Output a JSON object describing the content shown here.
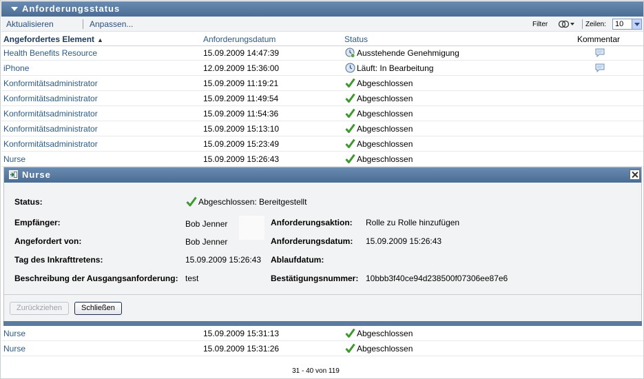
{
  "portlet": {
    "title": "Anforderungsstatus"
  },
  "toolbar": {
    "refresh_label": "Aktualisieren",
    "customize_label": "Anpassen...",
    "filter_label": "Filter",
    "rows_label": "Zeilen:",
    "rows_value": "10"
  },
  "columns": {
    "element": "Angefordertes Element",
    "date": "Anforderungsdatum",
    "status": "Status",
    "comment": "Kommentar"
  },
  "rows_top": [
    {
      "element": "Health Benefits Resource",
      "date": "15.09.2009 14:47:39",
      "status": "Ausstehende Genehmigung",
      "status_kind": "pending",
      "comment": true
    },
    {
      "element": "iPhone",
      "date": "12.09.2009 15:36:00",
      "status": "Läuft: In Bearbeitung",
      "status_kind": "running",
      "comment": true
    },
    {
      "element": "Konformitätsadministrator",
      "date": "15.09.2009 11:19:21",
      "status": "Abgeschlossen",
      "status_kind": "done",
      "comment": false
    },
    {
      "element": "Konformitätsadministrator",
      "date": "15.09.2009 11:49:54",
      "status": "Abgeschlossen",
      "status_kind": "done",
      "comment": false
    },
    {
      "element": "Konformitätsadministrator",
      "date": "15.09.2009 11:54:36",
      "status": "Abgeschlossen",
      "status_kind": "done",
      "comment": false
    },
    {
      "element": "Konformitätsadministrator",
      "date": "15.09.2009 15:13:10",
      "status": "Abgeschlossen",
      "status_kind": "done",
      "comment": false
    },
    {
      "element": "Konformitätsadministrator",
      "date": "15.09.2009 15:23:49",
      "status": "Abgeschlossen",
      "status_kind": "done",
      "comment": false
    },
    {
      "element": "Nurse",
      "date": "15.09.2009 15:26:43",
      "status": "Abgeschlossen",
      "status_kind": "done",
      "comment": false
    }
  ],
  "detail": {
    "title": "Nurse",
    "status_label": "Status:",
    "status_value": "Abgeschlossen: Bereitgestellt",
    "recipient_label": "Empfänger:",
    "recipient_value": "Bob Jenner",
    "requested_by_label": "Angefordert von:",
    "requested_by_value": "Bob Jenner",
    "effective_label": "Tag des Inkrafttretens:",
    "effective_value": "15.09.2009 15:26:43",
    "description_label": "Beschreibung der Ausgangsanforderung:",
    "description_value": "test",
    "action_label": "Anforderungsaktion:",
    "action_value": "Rolle zu Rolle hinzufügen",
    "req_date_label": "Anforderungsdatum:",
    "req_date_value": "15.09.2009 15:26:43",
    "expiry_label": "Ablaufdatum:",
    "expiry_value": "",
    "confirmation_label": "Bestätigungsnummer:",
    "confirmation_value": "10bbb3f40ce94d238500f07306ee87e6",
    "retract_label": "Zurückziehen",
    "close_label": "Schließen"
  },
  "rows_bottom": [
    {
      "element": "Nurse",
      "date": "15.09.2009 15:31:13",
      "status": "Abgeschlossen",
      "status_kind": "done"
    },
    {
      "element": "Nurse",
      "date": "15.09.2009 15:31:26",
      "status": "Abgeschlossen",
      "status_kind": "done"
    }
  ],
  "pager": {
    "text": "31 - 40 von 119"
  },
  "colors": {
    "header_blue": "#4a6d95",
    "link_blue": "#2a5a8c",
    "check_green": "#3a9a2a"
  }
}
